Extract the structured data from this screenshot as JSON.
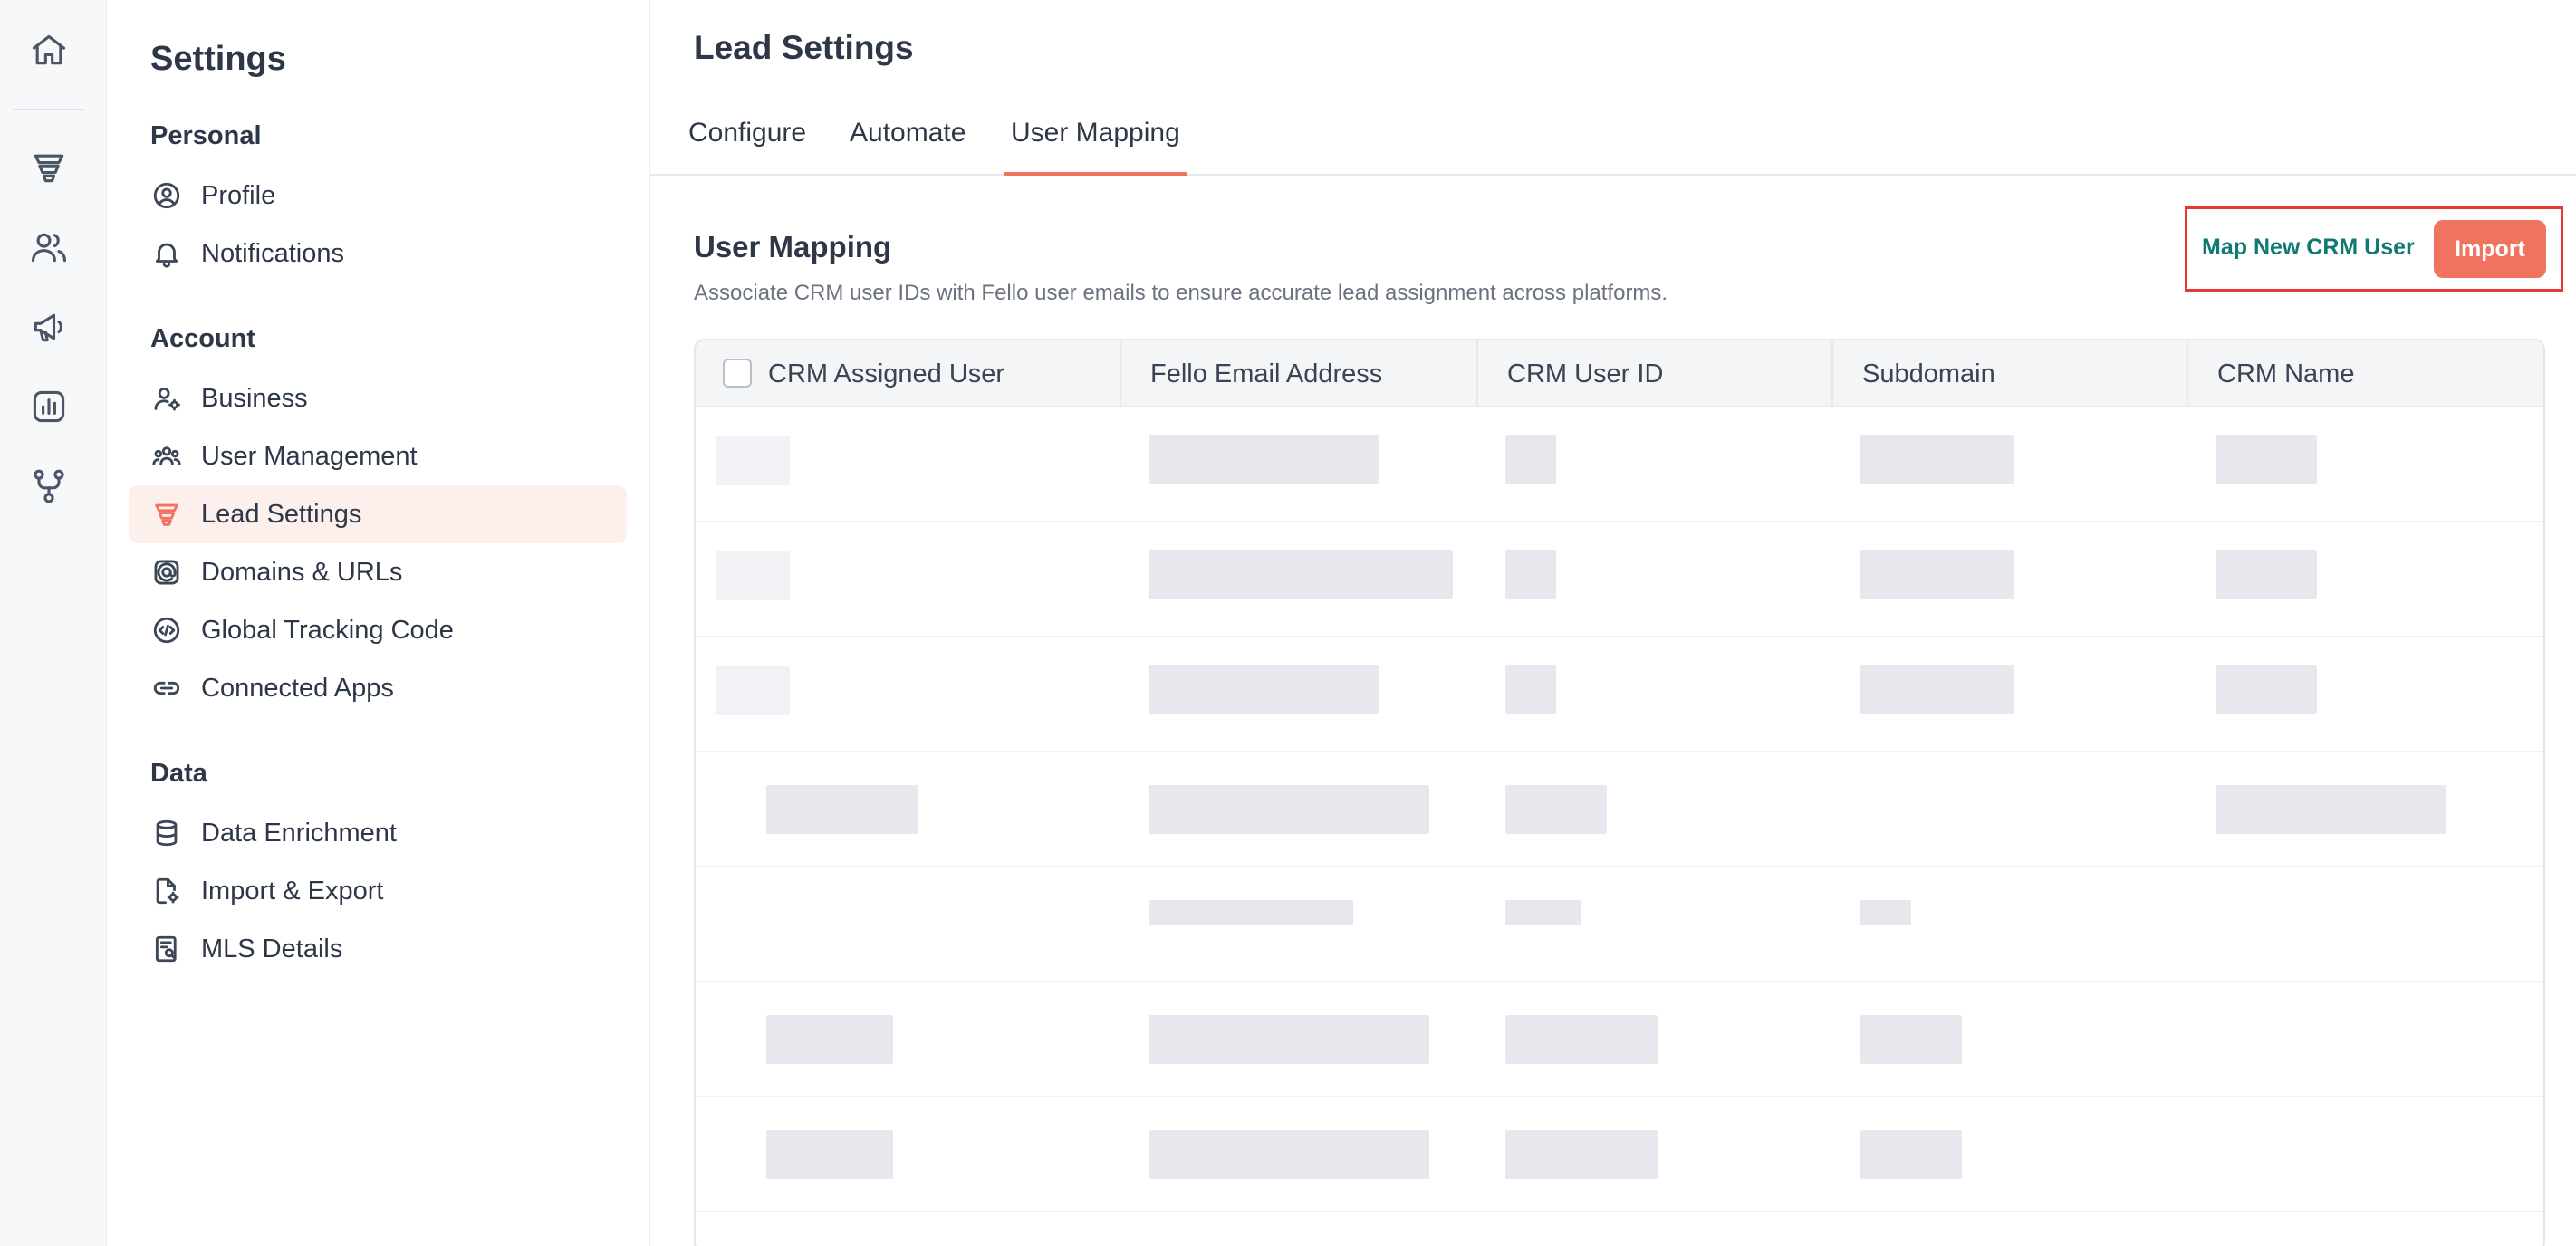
{
  "rail": {
    "icons": [
      "home-icon",
      "funnel-icon",
      "users-icon",
      "megaphone-icon",
      "analytics-icon",
      "workflow-icon"
    ]
  },
  "sidebar": {
    "title": "Settings",
    "sections": {
      "personal": "Personal",
      "account": "Account",
      "data": "Data"
    },
    "items": {
      "profile": "Profile",
      "notifications": "Notifications",
      "business": "Business",
      "user_management": "User Management",
      "lead_settings": "Lead Settings",
      "domains": "Domains & URLs",
      "tracking": "Global Tracking Code",
      "connected_apps": "Connected Apps",
      "data_enrichment": "Data Enrichment",
      "import_export": "Import & Export",
      "mls_details": "MLS Details"
    },
    "active_item": "Lead Settings"
  },
  "main": {
    "title": "Lead Settings",
    "tabs": {
      "configure": "Configure",
      "automate": "Automate",
      "user_mapping": "User Mapping"
    },
    "active_tab": "User Mapping",
    "section_title": "User Mapping",
    "section_desc": "Associate CRM user IDs with Fello user emails to ensure accurate lead assignment across platforms.",
    "actions": {
      "map_new": "Map New CRM User",
      "import": "Import"
    },
    "table": {
      "columns": {
        "crm_user": "CRM Assigned User",
        "email": "Fello Email Address",
        "user_id": "CRM User ID",
        "subdomain": "Subdomain",
        "crm_name": "CRM Name"
      },
      "row_count": 7,
      "rows_note_hidden": true
    }
  },
  "colors": {
    "accent": "#f07360",
    "active_bg": "#fdefec",
    "link": "#0e7a72",
    "highlight_box": "#e53935"
  }
}
